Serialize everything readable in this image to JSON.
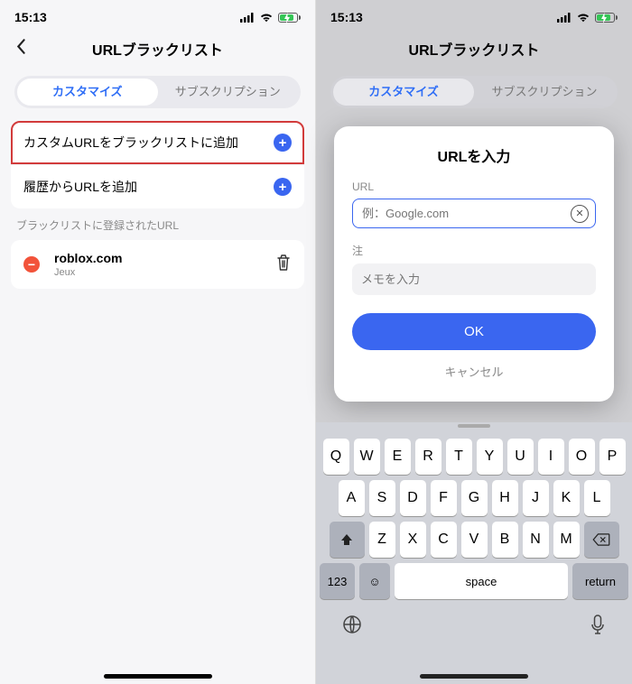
{
  "status": {
    "time": "15:13",
    "doc_icon": "▮"
  },
  "header": {
    "title": "URLブラックリスト"
  },
  "segments": {
    "custom": "カスタマイズ",
    "subscription": "サブスクリプション"
  },
  "left": {
    "add_custom": "カスタムURLをブラックリストに追加",
    "add_history": "履歴からURLを追加",
    "section_label": "ブラックリストに登録されたURL",
    "item_title": "roblox.com",
    "item_sub": "Jeux"
  },
  "modal": {
    "title": "URLを入力",
    "url_label": "URL",
    "url_placeholder": "例：Google.com",
    "note_label": "注",
    "memo_placeholder": "メモを入力",
    "ok": "OK",
    "cancel": "キャンセル"
  },
  "keyboard": {
    "row1": [
      "Q",
      "W",
      "E",
      "R",
      "T",
      "Y",
      "U",
      "I",
      "O",
      "P"
    ],
    "row2": [
      "A",
      "S",
      "D",
      "F",
      "G",
      "H",
      "J",
      "K",
      "L"
    ],
    "row3": [
      "Z",
      "X",
      "C",
      "V",
      "B",
      "N",
      "M"
    ],
    "k123": "123",
    "space": "space",
    "return": "return"
  }
}
